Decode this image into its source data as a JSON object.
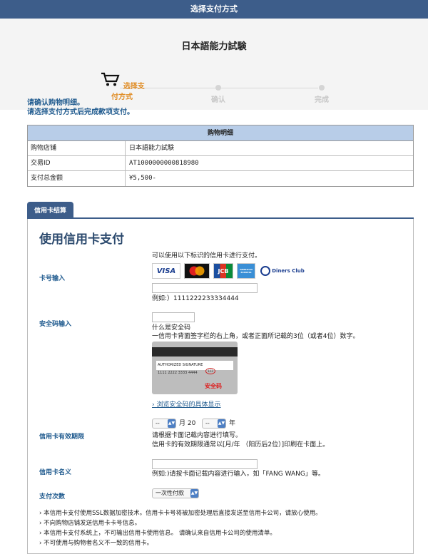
{
  "header": {
    "title": "选择支付方式"
  },
  "page": {
    "title": "日本語能力試験"
  },
  "steps": [
    {
      "label": "选择支付方式"
    },
    {
      "label": "确认"
    },
    {
      "label": "完成"
    }
  ],
  "messages": [
    "请确认购物明细。",
    "请选择支付方式后完成款项支付。"
  ],
  "cart": {
    "header": "购物明细",
    "rows": [
      {
        "key": "购物店铺",
        "value": "日本語能力試験"
      },
      {
        "key": "交易ID",
        "value": "AT1000000000818980"
      },
      {
        "key": "支付总金额",
        "value": "¥5,500-"
      }
    ]
  },
  "tab": {
    "label": "信用卡结算"
  },
  "form": {
    "title": "使用信用卡支付",
    "brands_note": "可以使用以下标识的信用卡进行支付。",
    "brands": [
      "VISA",
      "mastercard",
      "JCB",
      "AMERICAN EXPRESS",
      "Diners Club"
    ],
    "card_number": {
      "label": "卡号输入",
      "value": "",
      "example": "例如:）1111222233334444"
    },
    "security_code": {
      "label": "安全码输入",
      "value": "",
      "what": "什么是安全码",
      "desc": "一信用卡背面签字栏的右上角，或者正面所记载的3位（或者4位）数字。",
      "image_sig": "AUTHORIZED SIGNATURE",
      "image_number": "1111 2222 3333 4444",
      "image_code": "123",
      "image_caption": "安全码",
      "link": "浏览安全码的具体显示"
    },
    "expiry": {
      "label": "信用卡有效期限",
      "month": "--",
      "month_unit": "月",
      "year_prefix": "20",
      "year": "--",
      "year_unit": "年",
      "hint1": "请根据卡面记载内容进行填写。",
      "hint2": "信用卡的有效期限通常以[月/年 （阳历后2位）]印刷在卡面上。"
    },
    "name": {
      "label": "信用卡名义",
      "value": "",
      "hint": "例如:)请按卡面记载内容进行输入，如「FANG WANG」等。"
    },
    "installments": {
      "label": "支付次数",
      "value": "一次性付款"
    }
  },
  "notes": [
    "本信用卡支付使用SSL数据加密技术。信用卡卡号将被加密处理后直接发送至信用卡公司，请放心使用。",
    "不向购物店铺发送信用卡卡号信息。",
    "本信用卡支付系统上，不可输出信用卡使用信息。 请确认来自信用卡公司的使用清单。",
    "不可使用与购物者名义不一致的信用卡。"
  ],
  "colors": {
    "header": "#3d5d8a",
    "active_step": "#e08b22",
    "label": "#1f5a8e"
  }
}
